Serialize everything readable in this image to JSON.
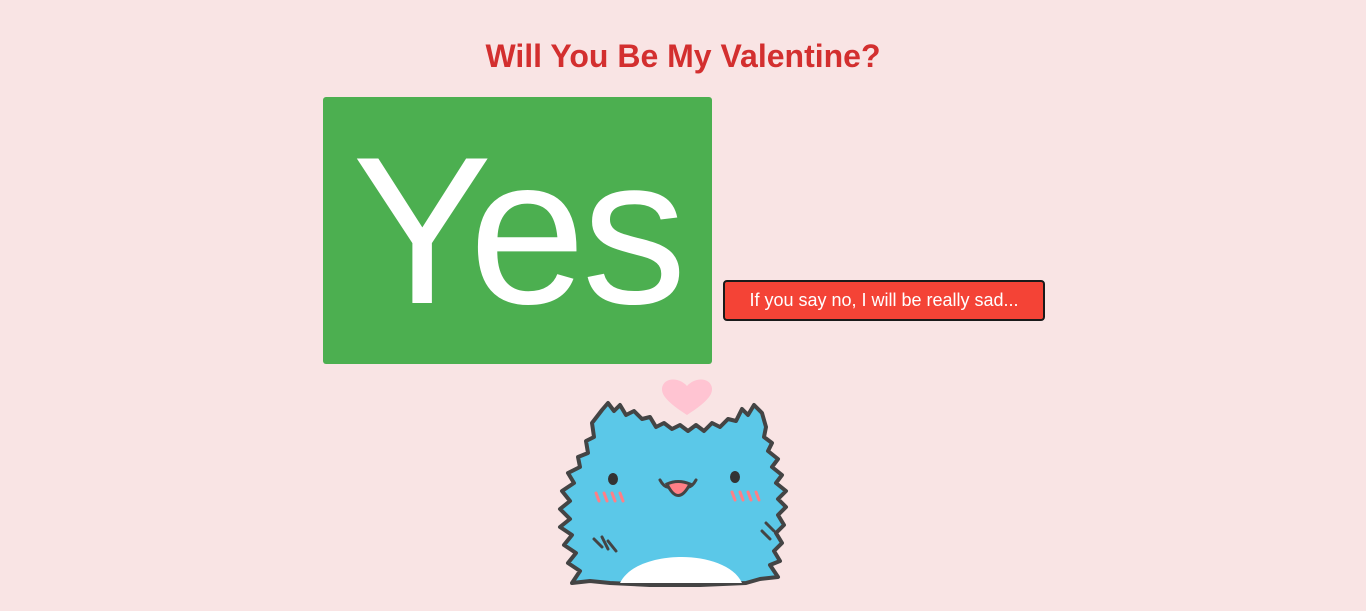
{
  "header": {
    "title": "Will You Be My Valentine?"
  },
  "buttons": {
    "yes_label": "Yes",
    "no_label": "If you say no, I will be really sad..."
  },
  "illustration": {
    "icon": "happy-blue-cat-with-heart-icon"
  },
  "colors": {
    "background": "#f9e4e4",
    "title": "#d32f2f",
    "yes": "#4caf50",
    "no": "#f44336",
    "cat": "#5bc8e8",
    "heart": "#ffc4d2"
  }
}
